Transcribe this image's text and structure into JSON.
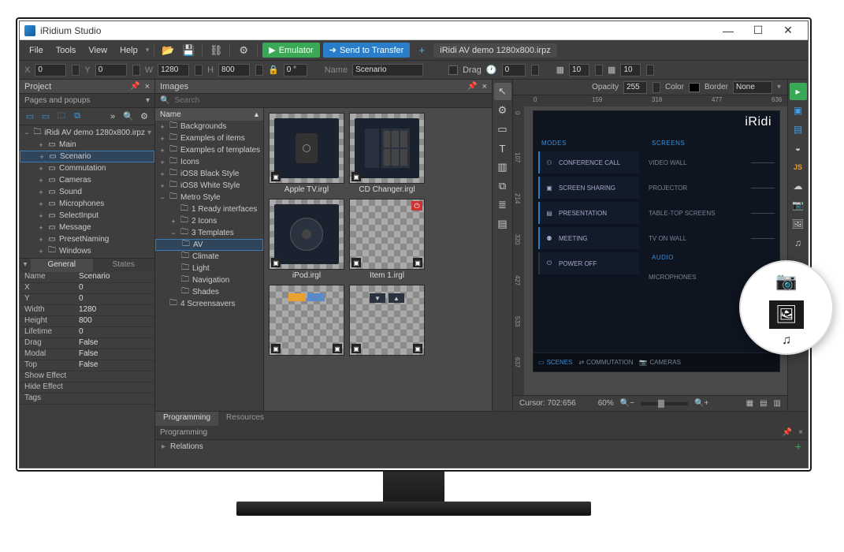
{
  "title": "iRidium Studio",
  "menu": {
    "file": "File",
    "tools": "Tools",
    "view": "View",
    "help": "Help"
  },
  "actions": {
    "emulator": "Emulator",
    "send": "Send to Transfer"
  },
  "open_tab": "iRidi AV demo 1280x800.irpz",
  "propbar": {
    "x_lbl": "X",
    "x": "0",
    "y_lbl": "Y",
    "y": "0",
    "w_lbl": "W",
    "w": "1280",
    "h_lbl": "H",
    "h": "800",
    "lock_deg": "0 °",
    "name_lbl": "Name",
    "name": "Scenario",
    "drag_lbl": "Drag",
    "time_lbl": "",
    "time": "0",
    "n1": "10",
    "n2": "10"
  },
  "left": {
    "project": "Project",
    "pages": "Pages and popups",
    "root": "iRidi AV demo 1280x800.irpz",
    "items": [
      "Main",
      "Scenario",
      "Commutation",
      "Cameras",
      "Sound",
      "Microphones",
      "SelectInput",
      "Message",
      "PresetNaming",
      "Windows"
    ],
    "tabs": {
      "general": "General",
      "states": "States"
    },
    "props": [
      [
        "Name",
        "Scenario"
      ],
      [
        "X",
        "0"
      ],
      [
        "Y",
        "0"
      ],
      [
        "Width",
        "1280"
      ],
      [
        "Height",
        "800"
      ],
      [
        "Lifetime",
        "0"
      ],
      [
        "Drag",
        "False"
      ],
      [
        "Modal",
        "False"
      ],
      [
        "Top",
        "False"
      ],
      [
        "Show Effect",
        ""
      ],
      [
        "Hide Effect",
        ""
      ],
      [
        "Tags",
        ""
      ]
    ]
  },
  "images": {
    "title": "Images",
    "search": "Search",
    "col": "Name",
    "folders": [
      "Backgrounds",
      "Examples of items",
      "Examples of templates",
      "Icons",
      "iOS8 Black Style",
      "iOS8 White Style",
      "Metro Style"
    ],
    "metro": [
      "1 Ready interfaces",
      "2 Icons",
      "3 Templates"
    ],
    "templates": [
      "AV",
      "Climate",
      "Light",
      "Navigation",
      "Shades"
    ],
    "last": "4 Screensavers",
    "thumbs": [
      "Apple TV.irgl",
      "CD Changer.irgl",
      "iPod.irgl",
      "Item 1.irgl",
      "",
      ""
    ]
  },
  "prog": {
    "tab1": "Programming",
    "tab2": "Resources",
    "header": "Programming",
    "row": "Relations"
  },
  "canvas": {
    "opacity_lbl": "Opacity",
    "opacity": "255",
    "color_lbl": "Color",
    "border_lbl": "Border",
    "border": "None",
    "ruler_h": [
      "0",
      "159",
      "318",
      "477",
      "636"
    ],
    "ruler_v": [
      "0",
      "107",
      "214",
      "320",
      "427",
      "533",
      "637"
    ],
    "cursor": "Cursor: 702:656",
    "zoom": "60%"
  },
  "preview": {
    "brand": "iRidi",
    "modes_title": "MODES",
    "screens_title": "SCREENS",
    "audio_title": "AUDIO",
    "modes": [
      "CONFERENCE CALL",
      "SCREEN SHARING",
      "PRESENTATION",
      "MEETING",
      "POWER OFF"
    ],
    "screens": [
      "VIDEO WALL",
      "PROJECTOR",
      "TABLE-TOP SCREENS",
      "TV ON WALL"
    ],
    "audio": [
      "MICROPHONES"
    ],
    "nav": [
      "SCENES",
      "COMMUTATION",
      "CAMERAS"
    ]
  }
}
